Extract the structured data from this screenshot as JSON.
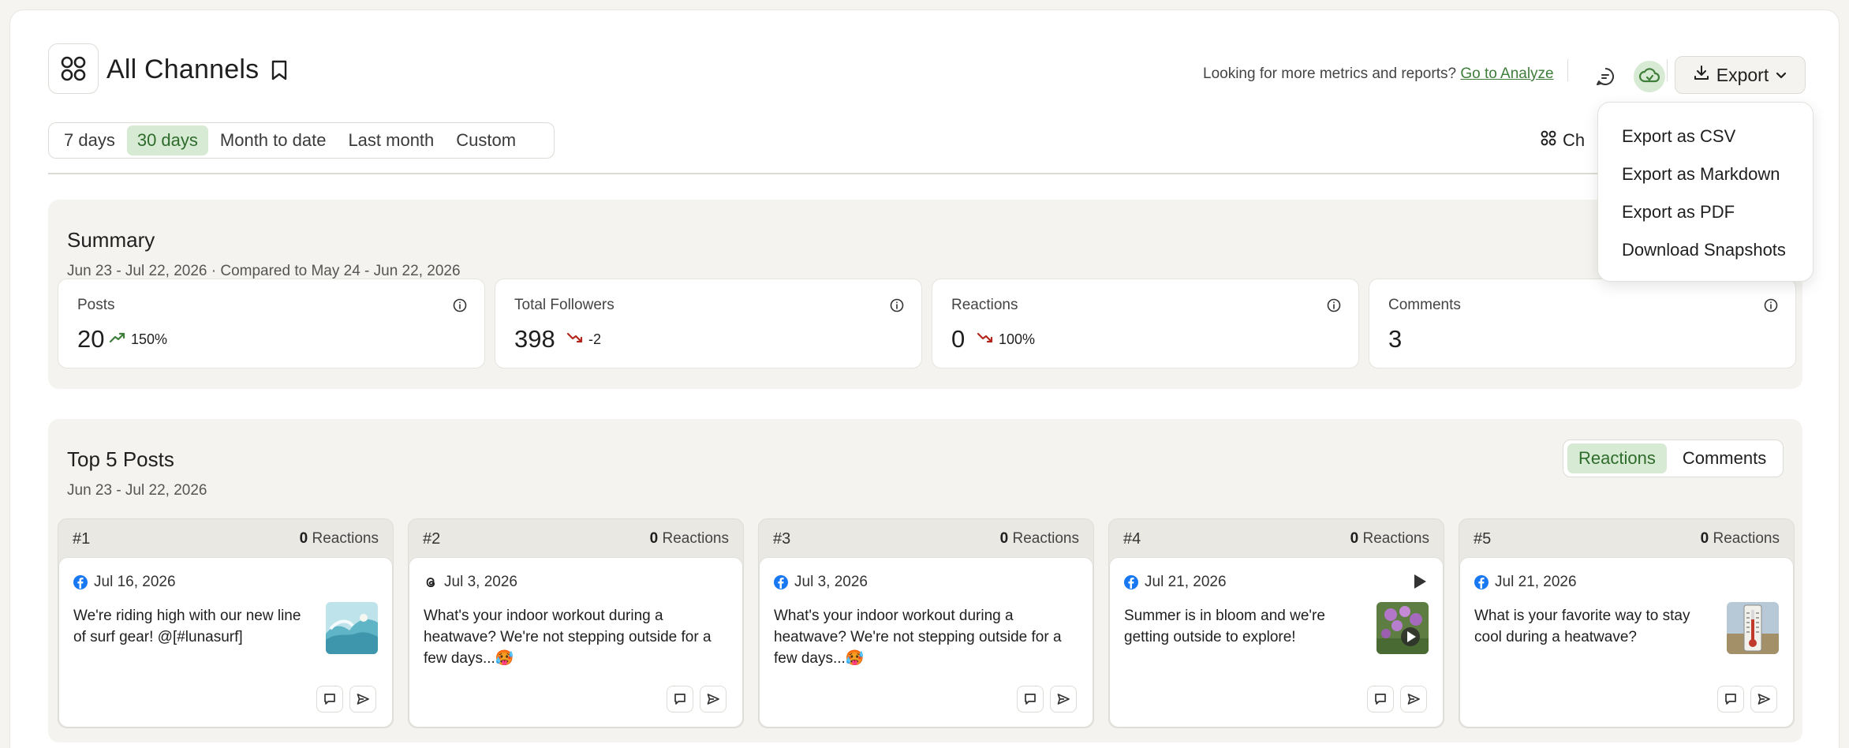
{
  "header": {
    "title": "All Channels",
    "analyze_prompt": "Looking for more metrics and reports?",
    "analyze_link": "Go to Analyze",
    "export_label": "Export"
  },
  "range_tabs": [
    {
      "label": "7 days",
      "active": false
    },
    {
      "label": "30 days",
      "active": true
    },
    {
      "label": "Month to date",
      "active": false
    },
    {
      "label": "Last month",
      "active": false
    },
    {
      "label": "Custom",
      "active": false
    }
  ],
  "channels_button_label": "Ch",
  "export_menu": {
    "items": [
      "Export as CSV",
      "Export as Markdown",
      "Export as PDF",
      "Download Snapshots"
    ]
  },
  "summary": {
    "title": "Summary",
    "subtitle": "Jun 23 - Jul 22, 2026 · Compared to May 24 - Jun 22, 2026",
    "metrics": [
      {
        "label": "Posts",
        "value": "20",
        "trend": "150%",
        "direction": "up"
      },
      {
        "label": "Total Followers",
        "value": "398",
        "trend": "-2",
        "direction": "down"
      },
      {
        "label": "Reactions",
        "value": "0",
        "trend": "100%",
        "direction": "down"
      },
      {
        "label": "Comments",
        "value": "3",
        "trend": "",
        "direction": "none"
      }
    ]
  },
  "top_posts": {
    "title": "Top 5 Posts",
    "subtitle": "Jun 23 - Jul 22, 2026",
    "toggle": [
      {
        "label": "Reactions",
        "active": true
      },
      {
        "label": "Comments",
        "active": false
      }
    ],
    "posts": [
      {
        "rank": "#1",
        "count": "0",
        "count_label": "Reactions",
        "network": "facebook",
        "date": "Jul 16, 2026",
        "text": "We're riding high with our new line of surf gear! @[#lunasurf]",
        "thumb": "wave"
      },
      {
        "rank": "#2",
        "count": "0",
        "count_label": "Reactions",
        "network": "threads",
        "date": "Jul 3, 2026",
        "text": "What's your indoor workout during a heatwave? We're not stepping outside for a few days...🥵",
        "thumb": ""
      },
      {
        "rank": "#3",
        "count": "0",
        "count_label": "Reactions",
        "network": "facebook",
        "date": "Jul 3, 2026",
        "text": "What's your indoor workout during a heatwave? We're not stepping outside for a few days...🥵",
        "thumb": ""
      },
      {
        "rank": "#4",
        "count": "0",
        "count_label": "Reactions",
        "network": "facebook",
        "date": "Jul 21, 2026",
        "text": "Summer is in bloom and we're getting outside to explore!",
        "thumb": "flowers-video"
      },
      {
        "rank": "#5",
        "count": "0",
        "count_label": "Reactions",
        "network": "facebook",
        "date": "Jul 21, 2026",
        "text": "What is your favorite way to stay cool during a heatwave?",
        "thumb": "thermometer"
      }
    ]
  },
  "colors": {
    "accent_green": "#3e7d3a",
    "active_tab_bg": "#d7ead3",
    "trend_down": "#b3261e",
    "trend_up": "#3e7d3a",
    "facebook_blue": "#1877f2"
  }
}
